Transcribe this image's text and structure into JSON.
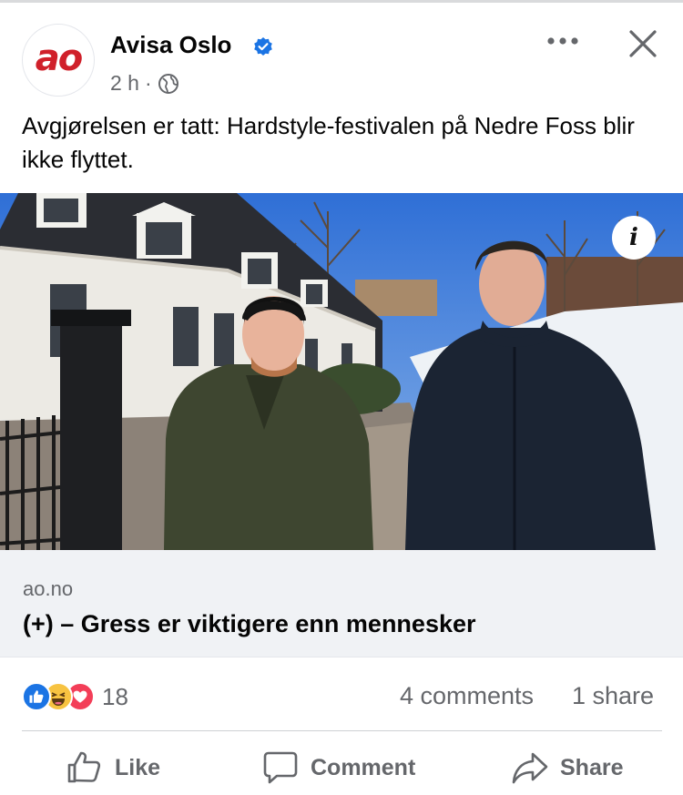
{
  "post": {
    "avatar_text": "ao",
    "page_name": "Avisa Oslo",
    "time": "2 h",
    "separator": "·",
    "text": "Avgjørelsen er tatt: Hardstyle-festivalen på Nedre Foss blir ikke flyttet."
  },
  "link_preview": {
    "info_glyph": "i",
    "domain": "ao.no",
    "title": "(+)  – Gress er viktigere enn mennesker"
  },
  "stats": {
    "reactions_count": "18",
    "comments": "4 comments",
    "shares": "1 share"
  },
  "actions": {
    "like": "Like",
    "comment": "Comment",
    "share": "Share"
  },
  "colors": {
    "brand_red": "#d0202a",
    "verified_blue": "#1b74e4",
    "secondary_text": "#65676b"
  },
  "icons": [
    "verified-badge-icon",
    "globe-icon",
    "more-icon",
    "close-icon",
    "info-icon",
    "like-reaction-icon",
    "haha-reaction-icon",
    "love-reaction-icon",
    "thumbs-up-icon",
    "comment-icon",
    "share-icon"
  ]
}
